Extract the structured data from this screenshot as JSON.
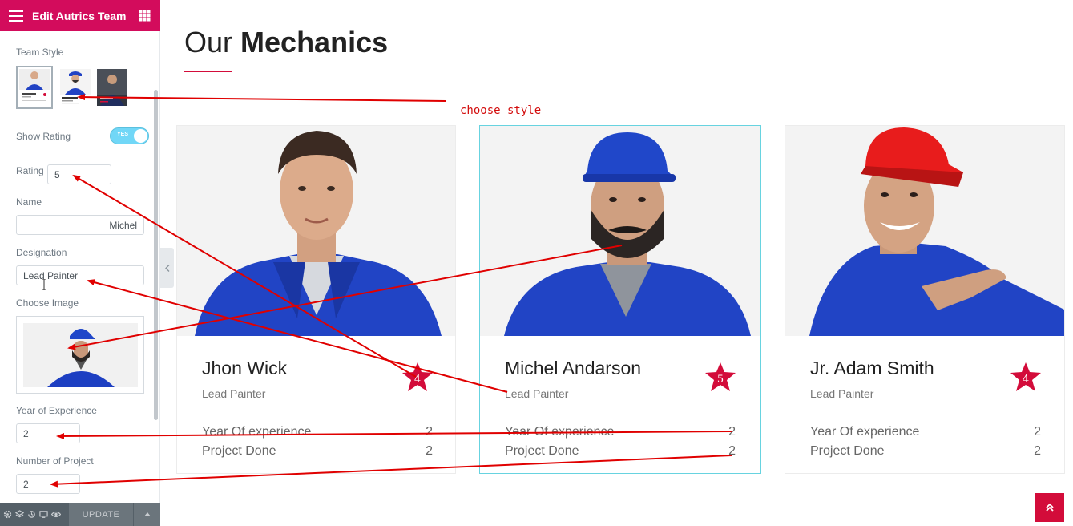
{
  "panel": {
    "title": "Edit Autrics Team",
    "team_style_label": "Team Style",
    "show_rating_label": "Show Rating",
    "show_rating_toggle": "YES",
    "rating_label": "Rating",
    "rating_value": "5",
    "name_label": "Name",
    "name_value": "Michel",
    "designation_label": "Designation",
    "designation_value": "Lead Painter",
    "choose_image_label": "Choose Image",
    "experience_label": "Year of Experience",
    "experience_value": "2",
    "projects_label": "Number of Project",
    "projects_value": "2",
    "update_label": "UPDATE"
  },
  "heading": {
    "light": "Our",
    "bold": "Mechanics"
  },
  "annotation": "choose style",
  "cards": [
    {
      "name": "Jhon Wick",
      "designation": "Lead Painter",
      "rating": "4",
      "experience_label": "Year Of experience",
      "experience_value": "2",
      "projects_label": "Project Done",
      "projects_value": "2"
    },
    {
      "name": "Michel Andarson",
      "designation": "Lead Painter",
      "rating": "5",
      "experience_label": "Year Of experience",
      "experience_value": "2",
      "projects_label": "Project Done",
      "projects_value": "2"
    },
    {
      "name": "Jr. Adam Smith",
      "designation": "Lead Painter",
      "rating": "4",
      "experience_label": "Year Of experience",
      "experience_value": "2",
      "projects_label": "Project Done",
      "projects_value": "2"
    }
  ],
  "colors": {
    "brand": "#d30c5c",
    "accent_red": "#d30c3a",
    "uniform_blue": "#1d3fc2",
    "active_border": "#67d3e0"
  }
}
